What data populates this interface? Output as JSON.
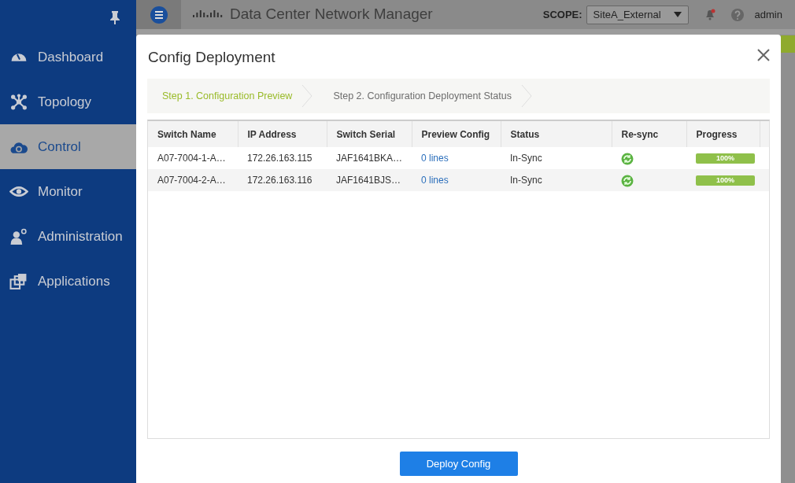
{
  "header": {
    "title": "Data Center Network Manager",
    "scope_label": "SCOPE:",
    "scope_value": "SiteA_External",
    "user": "admin"
  },
  "sidebar": {
    "items": [
      {
        "label": "Dashboard",
        "selected": false
      },
      {
        "label": "Topology",
        "selected": false
      },
      {
        "label": "Control",
        "selected": true
      },
      {
        "label": "Monitor",
        "selected": false
      },
      {
        "label": "Administration",
        "selected": false
      },
      {
        "label": "Applications",
        "selected": false
      }
    ]
  },
  "dialog": {
    "title": "Config Deployment",
    "steps": [
      {
        "label": "Step 1. Configuration Preview",
        "selected": true
      },
      {
        "label": "Step 2. Configuration Deployment Status",
        "selected": false
      }
    ],
    "table": {
      "columns": [
        "Switch Name",
        "IP Address",
        "Switch Serial",
        "Preview Config",
        "Status",
        "Re-sync",
        "Progress"
      ],
      "rows": [
        {
          "switch_name": "A07-7004-1-A…",
          "ip_address": "172.26.163.115",
          "switch_serial": "JAF1641BKA…",
          "preview_config": "0 lines",
          "status": "In-Sync",
          "progress": {
            "level": 1,
            "reading": "100%"
          }
        },
        {
          "switch_name": "A07-7004-2-A…",
          "ip_address": "172.26.163.116",
          "switch_serial": "JAF1641BJS…",
          "preview_config": "0 lines",
          "status": "In-Sync",
          "progress": {
            "level": 1,
            "reading": "100%"
          }
        }
      ]
    },
    "button": "Deploy Config"
  }
}
